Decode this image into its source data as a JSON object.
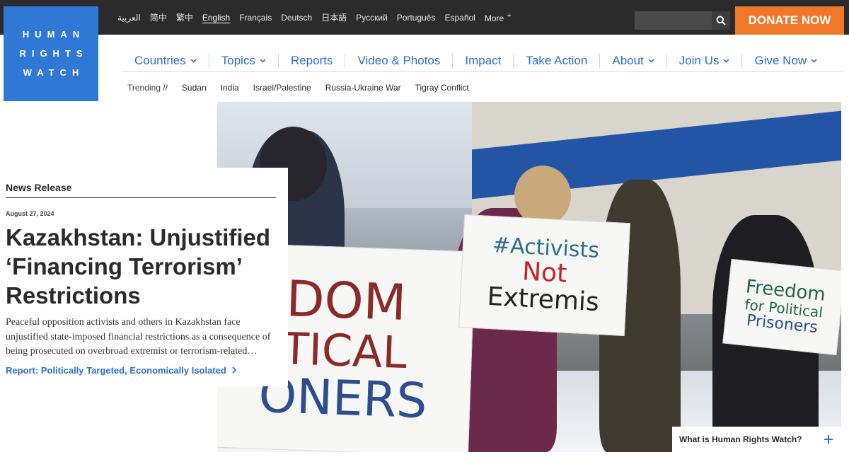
{
  "logo": {
    "lines": [
      "HUMAN",
      "RIGHTS",
      "WATCH"
    ]
  },
  "languages": [
    {
      "label": "العربية"
    },
    {
      "label": "简中"
    },
    {
      "label": "繁中"
    },
    {
      "label": "English",
      "active": true
    },
    {
      "label": "Français"
    },
    {
      "label": "Deutsch"
    },
    {
      "label": "日本語"
    },
    {
      "label": "Русский"
    },
    {
      "label": "Português"
    },
    {
      "label": "Español"
    },
    {
      "label": "More"
    }
  ],
  "search": {
    "placeholder": ""
  },
  "donate": {
    "label": "DONATE NOW"
  },
  "nav": [
    {
      "label": "Countries",
      "has_menu": true
    },
    {
      "label": "Topics",
      "has_menu": true
    },
    {
      "label": "Reports",
      "has_menu": false
    },
    {
      "label": "Video & Photos",
      "has_menu": false
    },
    {
      "label": "Impact",
      "has_menu": false
    },
    {
      "label": "Take Action",
      "has_menu": false
    },
    {
      "label": "About",
      "has_menu": true
    },
    {
      "label": "Join Us",
      "has_menu": true
    },
    {
      "label": "Give Now",
      "has_menu": true
    }
  ],
  "trending": {
    "label": "Trending //",
    "items": [
      "Sudan",
      "India",
      "Israel/Palestine",
      "Russia-Ukraine War",
      "Tigray Conflict"
    ]
  },
  "article": {
    "kicker": "News Release",
    "date": "August 27, 2024",
    "headline": "Kazakhstan: Unjustified ‘Financing Terrorism’ Restrictions",
    "summary": "Peaceful opposition activists and others in Kazakhstan face unjustified state-imposed financial restrictions as a consequence of being prosecuted on overbroad extremist or terrorism-related…",
    "link": "Report: Politically Targeted, Economically Isolated"
  },
  "hero": {
    "sign_left": [
      "DOM",
      "TICAL",
      "ONERS"
    ],
    "sign_center": [
      "#Activists",
      "Not",
      "Extremis"
    ],
    "sign_right": [
      "Freedom",
      "for Political",
      "Prisoners"
    ]
  },
  "what_is": {
    "label": "What is Human Rights Watch?"
  },
  "colors": {
    "brand_blue": "#2f78d6",
    "link_blue": "#2f6fc9",
    "donate_orange": "#f0782a",
    "topbar": "#2b2b2b"
  }
}
